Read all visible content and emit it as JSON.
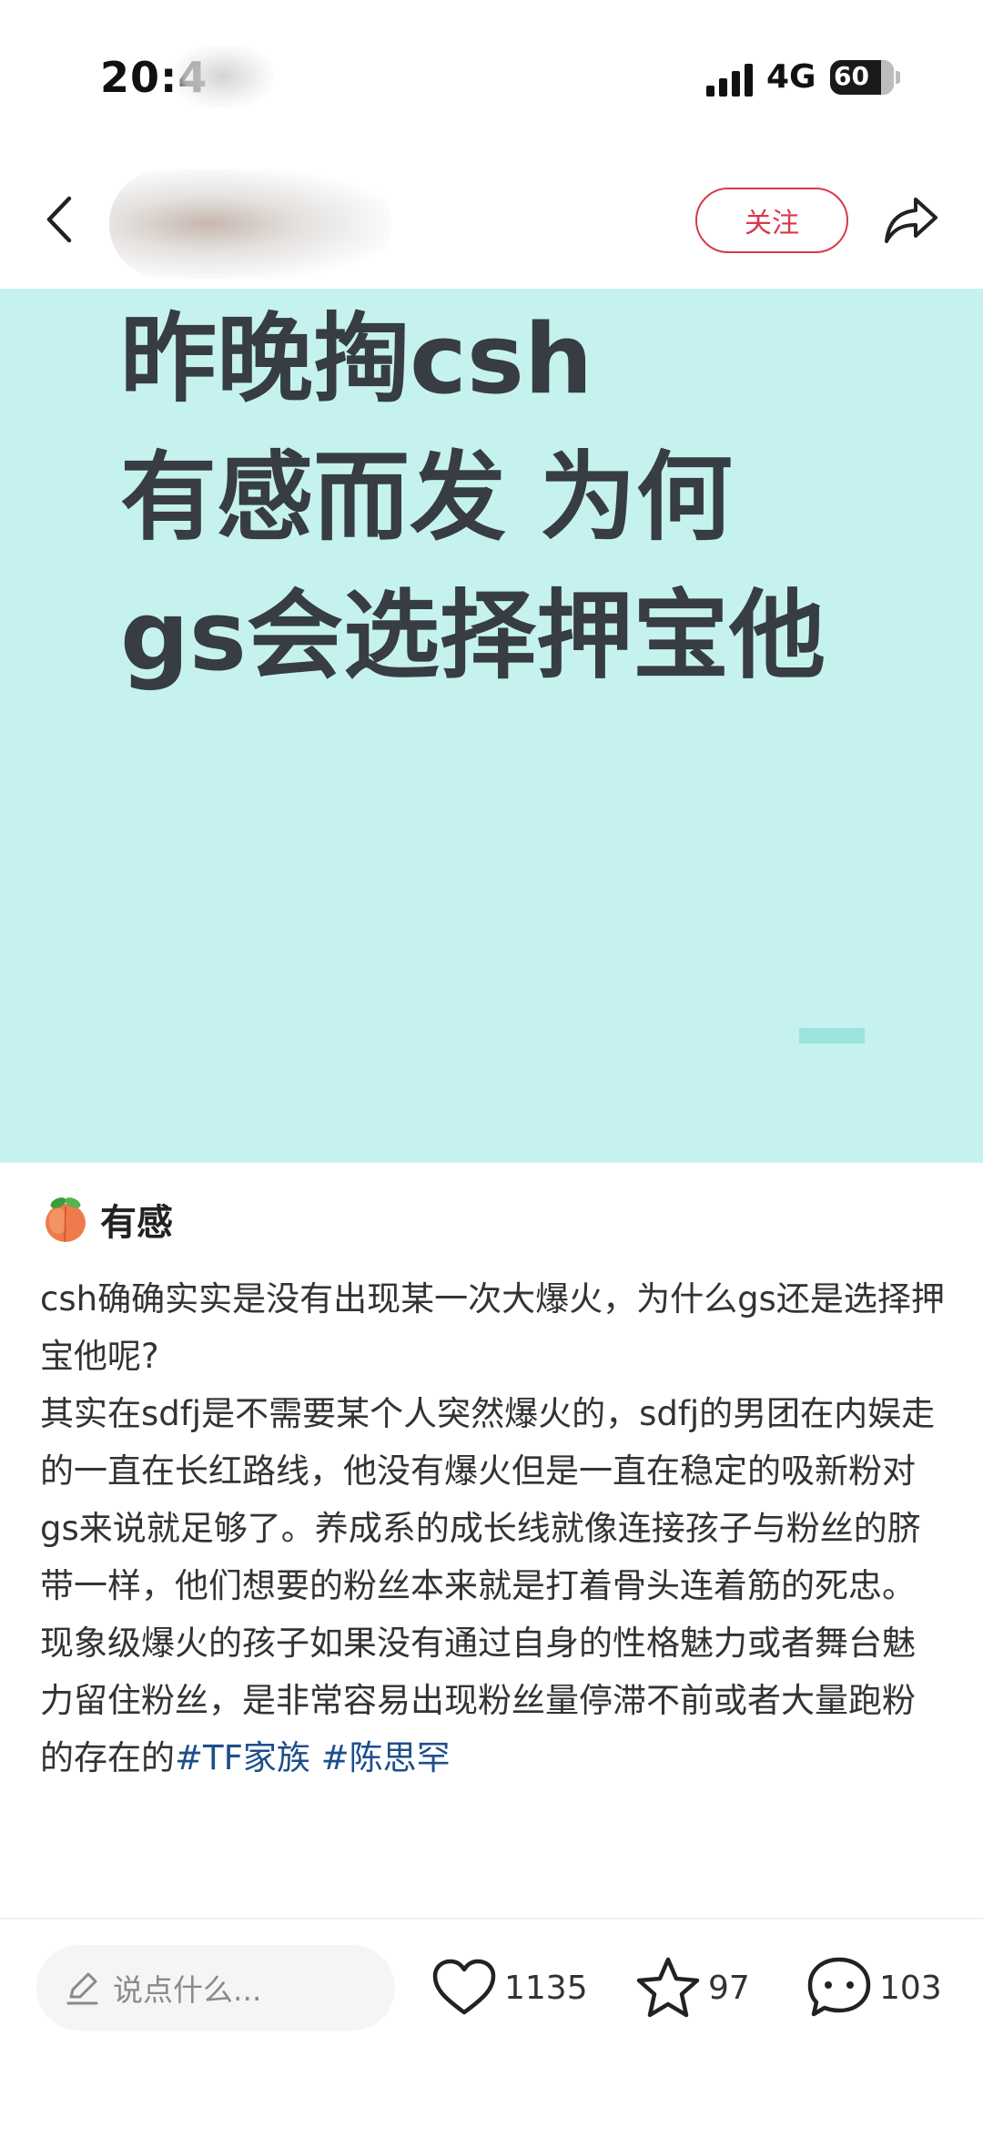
{
  "status_bar": {
    "time": "20:4",
    "network": "4G",
    "battery": "60"
  },
  "nav": {
    "follow_label": "关注"
  },
  "cover": {
    "lines": [
      "昨晚掏csh",
      "有感而发 为何",
      "gs会选择押宝他"
    ],
    "background": "#c5f2ee"
  },
  "post": {
    "title": "有感",
    "paragraphs": [
      "csh确确实实是没有出现某一次大爆火，为什么gs还是选择押宝他呢?",
      "其实在sdfj是不需要某个人突然爆火的，sdfj的男团在内娱走的一直在长红路线，他没有爆火但是一直在稳定的吸新粉对gs来说就足够了。养成系的成长线就像连接孩子与粉丝的脐带一样，他们想要的粉丝本来就是打着骨头连着筋的死忠。",
      "现象级爆火的孩子如果没有通过自身的性格魅力或者舞台魅力留住粉丝，是非常容易出现粉丝量停滞不前或者大量跑粉的存在的"
    ],
    "hashtags": [
      "#TF家族",
      "#陈思罕"
    ]
  },
  "bottom_bar": {
    "comment_placeholder": "说点什么...",
    "likes": "1135",
    "collects": "97",
    "comments": "103"
  },
  "colors": {
    "accent": "#d8394b",
    "hashtag": "#1d4f8c",
    "cover_text": "#373d42"
  },
  "icons": {
    "back": "back-arrow-icon",
    "share": "share-icon",
    "title_emoji": "peach-icon",
    "pencil": "pencil-icon",
    "like": "heart-icon",
    "collect": "star-icon",
    "comment": "comment-bubble-icon"
  }
}
